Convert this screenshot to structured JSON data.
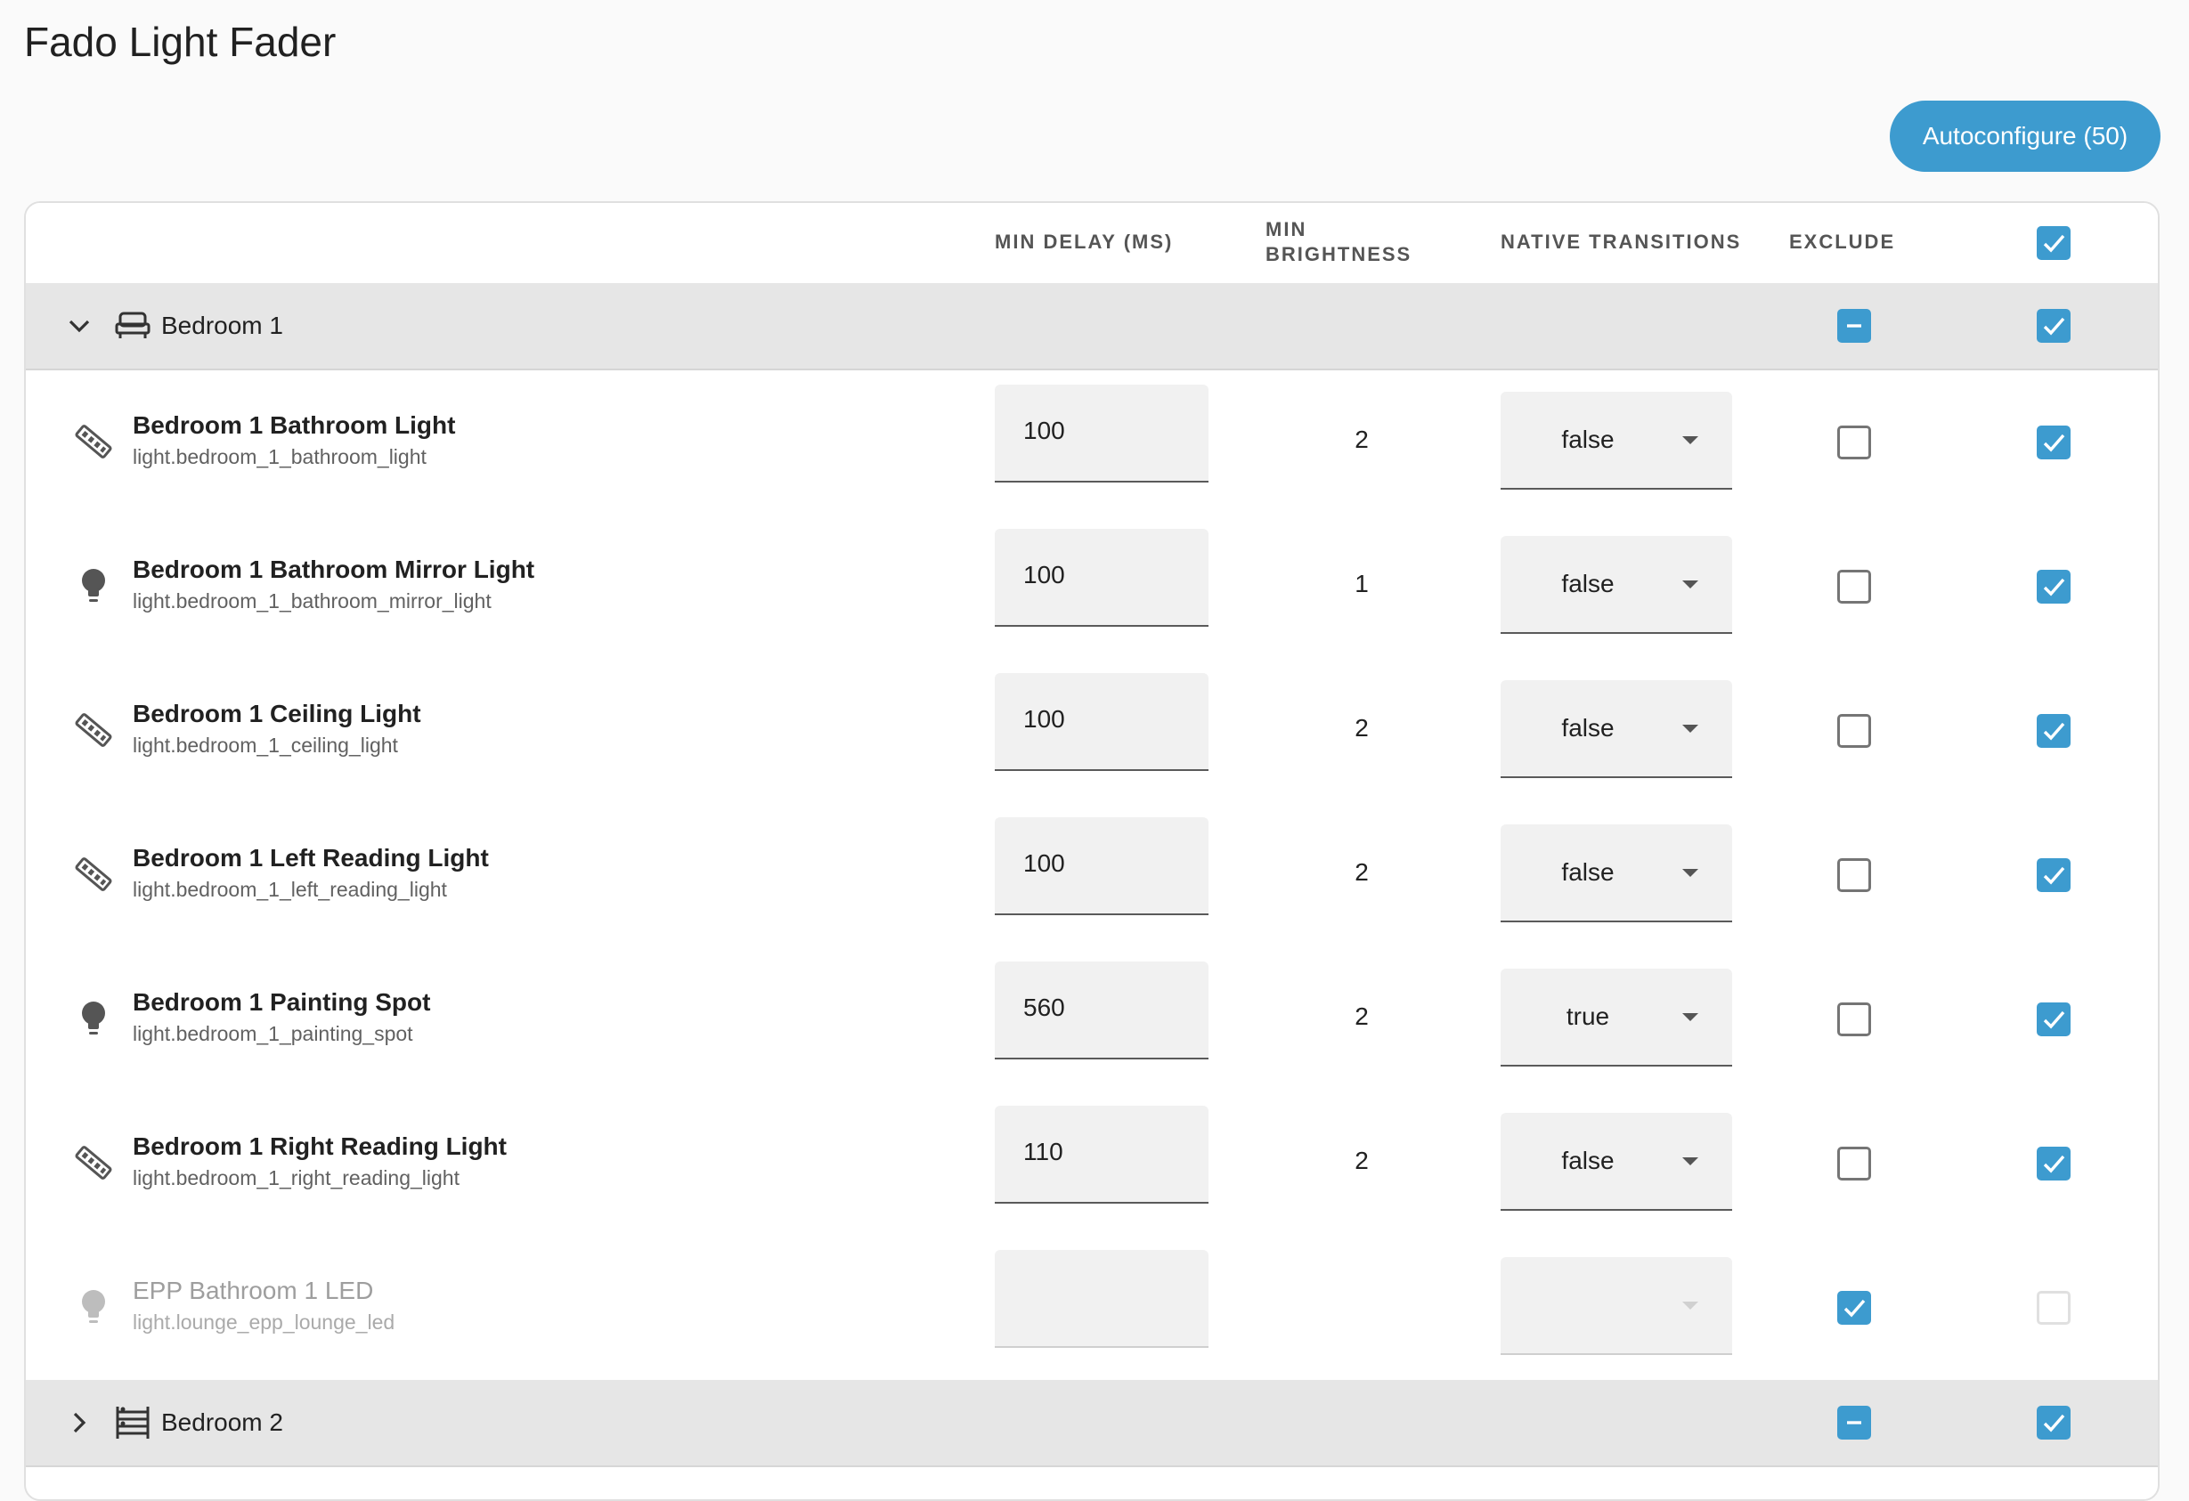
{
  "page": {
    "title": "Fado Light Fader"
  },
  "toolbar": {
    "autoconfigure_label": "Autoconfigure (50)"
  },
  "columns": {
    "min_delay": "MIN DELAY (MS)",
    "min_brightness_line1": "MIN",
    "min_brightness_line2": "BRIGHTNESS",
    "native_transitions": "NATIVE TRANSITIONS",
    "exclude": "EXCLUDE",
    "select_all_checked": true
  },
  "groups": [
    {
      "name": "Bedroom 1",
      "icon": "bed-icon",
      "expanded": true,
      "exclude_state": "indeterminate",
      "selected": true,
      "rows": [
        {
          "name": "Bedroom 1 Bathroom Light",
          "entity_id": "light.bedroom_1_bathroom_light",
          "icon": "led-strip-icon",
          "min_delay": "100",
          "min_brightness": "2",
          "native_transitions": "false",
          "exclude": false,
          "selected": true,
          "disabled": false
        },
        {
          "name": "Bedroom 1 Bathroom Mirror Light",
          "entity_id": "light.bedroom_1_bathroom_mirror_light",
          "icon": "lightbulb-icon",
          "min_delay": "100",
          "min_brightness": "1",
          "native_transitions": "false",
          "exclude": false,
          "selected": true,
          "disabled": false
        },
        {
          "name": "Bedroom 1 Ceiling Light",
          "entity_id": "light.bedroom_1_ceiling_light",
          "icon": "led-strip-icon",
          "min_delay": "100",
          "min_brightness": "2",
          "native_transitions": "false",
          "exclude": false,
          "selected": true,
          "disabled": false
        },
        {
          "name": "Bedroom 1 Left Reading Light",
          "entity_id": "light.bedroom_1_left_reading_light",
          "icon": "led-strip-icon",
          "min_delay": "100",
          "min_brightness": "2",
          "native_transitions": "false",
          "exclude": false,
          "selected": true,
          "disabled": false
        },
        {
          "name": "Bedroom 1 Painting Spot",
          "entity_id": "light.bedroom_1_painting_spot",
          "icon": "lightbulb-icon",
          "min_delay": "560",
          "min_brightness": "2",
          "native_transitions": "true",
          "exclude": false,
          "selected": true,
          "disabled": false
        },
        {
          "name": "Bedroom 1 Right Reading Light",
          "entity_id": "light.bedroom_1_right_reading_light",
          "icon": "led-strip-icon",
          "min_delay": "110",
          "min_brightness": "2",
          "native_transitions": "false",
          "exclude": false,
          "selected": true,
          "disabled": false
        },
        {
          "name": "EPP Bathroom 1 LED",
          "entity_id": "light.lounge_epp_lounge_led",
          "icon": "lightbulb-icon",
          "min_delay": "",
          "min_brightness": "",
          "native_transitions": "",
          "exclude": true,
          "selected": false,
          "disabled": true
        }
      ]
    },
    {
      "name": "Bedroom 2",
      "icon": "bunk-bed-icon",
      "expanded": false,
      "exclude_state": "indeterminate",
      "selected": true,
      "rows": []
    }
  ],
  "colors": {
    "accent": "#3d9bcf",
    "group_bg": "#e6e6e6",
    "field_bg": "#f1f1f1"
  }
}
